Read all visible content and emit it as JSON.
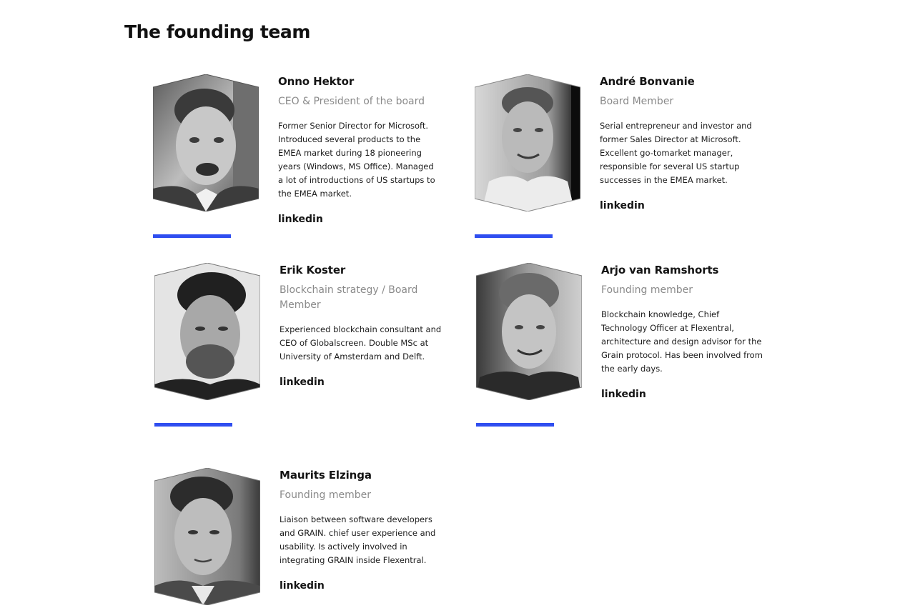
{
  "section": {
    "title": "The founding team"
  },
  "members": [
    {
      "name": "Onno Hektor",
      "role": "CEO & President of the board",
      "bio": "Former Senior Director for Microsoft. Introduced several products to the EMEA market during 18 pioneering years (Windows, MS Office). Managed a lot of introductions of US startups to the EMEA market.",
      "link": "linkedin"
    },
    {
      "name": "André Bonvanie",
      "role": "Board Member",
      "bio": "Serial entrepreneur and investor and former Sales Director at Microsoft. Excellent go-tomarket manager, responsible for several US startup successes in the EMEA market.",
      "link": "linkedin"
    },
    {
      "name": "Erik Koster",
      "role": "Blockchain strategy / Board Member",
      "bio": "Experienced blockchain consultant and CEO of Globalscreen. Double MSc at University of Amsterdam and Delft.",
      "link": "linkedin"
    },
    {
      "name": "Arjo van Ramshorts",
      "role": "Founding member",
      "bio": "Blockchain knowledge, Chief Technology Officer at Flexentral, architecture and design advisor for the Grain protocol. Has been involved from the early days.",
      "link": "linkedin"
    },
    {
      "name": "Maurits Elzinga",
      "role": "Founding member",
      "bio": "Liaison between software developers and GRAIN. chief user experience and usability. Is actively involved in integrating GRAIN inside Flexentral.",
      "link": "linkedin"
    }
  ],
  "colors": {
    "accent": "#2f4ef0",
    "role_text": "#8a8a8a",
    "text": "#141414"
  }
}
